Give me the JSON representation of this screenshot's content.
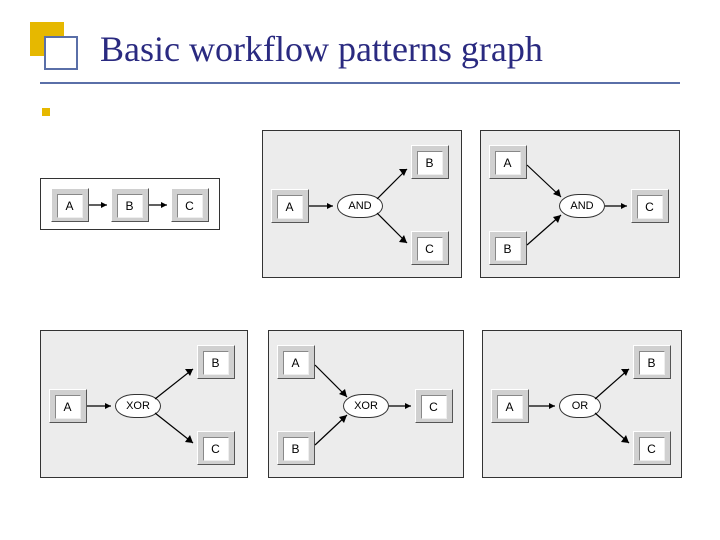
{
  "title": "Basic workflow patterns graph",
  "nodes": {
    "A": "A",
    "B": "B",
    "C": "C"
  },
  "operators": {
    "and": "AND",
    "xor": "XOR",
    "or": "OR"
  },
  "patterns": [
    {
      "id": "sequence",
      "nodes": [
        "A",
        "B",
        "C"
      ],
      "operator": null,
      "direction": "sequence"
    },
    {
      "id": "and-split",
      "nodes": [
        "A",
        "B",
        "C"
      ],
      "operator": "AND",
      "direction": "split"
    },
    {
      "id": "and-join",
      "nodes": [
        "A",
        "B",
        "C"
      ],
      "operator": "AND",
      "direction": "join"
    },
    {
      "id": "xor-split",
      "nodes": [
        "A",
        "B",
        "C"
      ],
      "operator": "XOR",
      "direction": "split"
    },
    {
      "id": "xor-join",
      "nodes": [
        "A",
        "B",
        "C"
      ],
      "operator": "XOR",
      "direction": "join"
    },
    {
      "id": "or-split",
      "nodes": [
        "A",
        "B",
        "C"
      ],
      "operator": "OR",
      "direction": "split"
    }
  ]
}
